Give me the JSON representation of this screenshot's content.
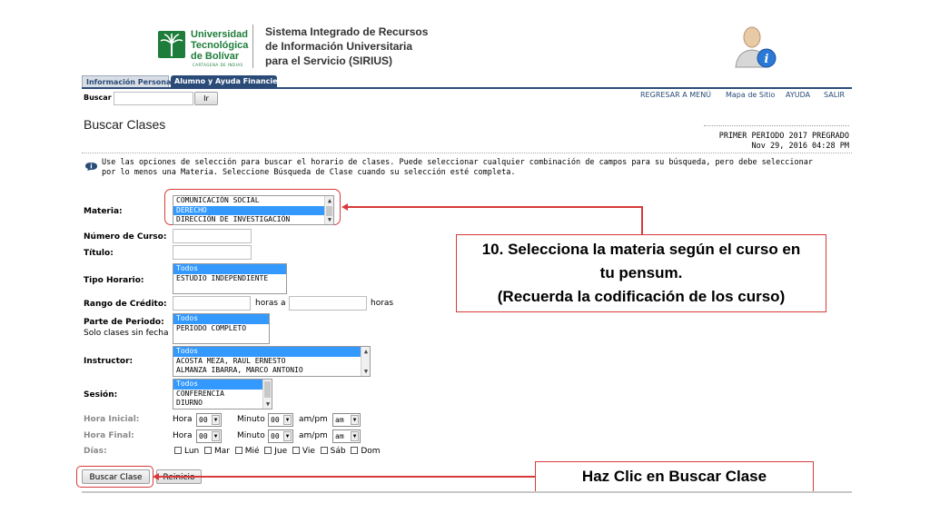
{
  "header": {
    "logo_line1": "Universidad",
    "logo_line2": "Tecnológica",
    "logo_line3": "de Bolívar",
    "logo_tagline": "CARTAGENA DE INDIAS",
    "system_title_1": "Sistema Integrado de Recursos",
    "system_title_2": "de Información Universitaria",
    "system_title_3": "para el Servicio (SIRIUS)"
  },
  "tabs": [
    {
      "label": "Información Personal"
    },
    {
      "label": "Alumno y Ayuda Financiera"
    }
  ],
  "search_bar": {
    "label": "Buscar",
    "button": "Ir",
    "value": ""
  },
  "top_links": [
    "REGRESAR A MENÚ",
    "Mapa de Sitio",
    "AYUDA",
    "SALIR"
  ],
  "page": {
    "title": "Buscar Clases",
    "term": "PRIMER PERIODO 2017 PREGRADO",
    "datetime": "Nov 29, 2016 04:28 PM",
    "info_text": "Use las opciones de selección para buscar el horario de clases. Puede seleccionar cualquier combinación de campos para su búsqueda, pero debe seleccionar por lo menos una Materia. Seleccione Búsqueda de Clase cuando su selección esté completa."
  },
  "form": {
    "materia_label": "Materia:",
    "materia_options": [
      "COMUNICACIÓN SOCIAL",
      "DERECHO",
      "DIRECCIÓN DE INVESTIGACIÓN"
    ],
    "numero_label": "Número de Curso:",
    "titulo_label": "Título:",
    "tipo_label": "Tipo Horario:",
    "tipo_options": [
      "Todos",
      "ESTUDIO INDEPENDIENTE"
    ],
    "credito_label": "Rango de Crédito:",
    "horas_a": "horas a",
    "horas": "horas",
    "parte_label": "Parte de Periodo:",
    "parte_sub": "Solo clases sin fecha",
    "parte_options": [
      "Todos",
      "PERIODO COMPLETO"
    ],
    "instructor_label": "Instructor:",
    "instructor_options": [
      "Todos",
      "ACOSTA MEZA, RAUL ERNESTO",
      "ALMANZA IBARRA, MARCO ANTONIO"
    ],
    "sesion_label": "Sesión:",
    "sesion_options": [
      "Todos",
      "CONFERENCIA",
      "DIURNO"
    ],
    "hora_inicial_label": "Hora Inicial:",
    "hora_final_label": "Hora Final:",
    "dias_label": "Días:",
    "hora_word": "Hora",
    "minuto_word": "Minuto",
    "ampm_word": "am/pm",
    "hour_value": "00",
    "minute_value": "00",
    "ampm_value": "am",
    "days": [
      "Lun",
      "Mar",
      "Mié",
      "Jue",
      "Vie",
      "Sáb",
      "Dom"
    ],
    "search_button": "Buscar Clase",
    "reset_button": "Reinicio"
  },
  "annotations": {
    "callout1_line1": "10. Selecciona la materia según el curso en",
    "callout1_line2": "tu pensum.",
    "callout1_line3": "(Recuerda la codificación de los curso)",
    "callout2": "Haz Clic en Buscar Clase",
    "color": "#d83a3a"
  },
  "colors": {
    "accent": "#2a4b78",
    "logo_green": "#1e7d3a",
    "selected": "#3399ff"
  }
}
